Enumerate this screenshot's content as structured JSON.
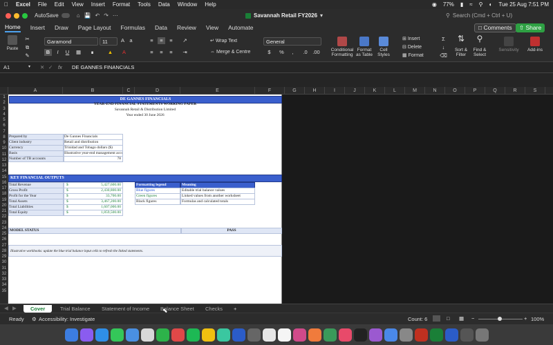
{
  "menubar": {
    "apple": "",
    "app": "Excel",
    "items": [
      "File",
      "Edit",
      "View",
      "Insert",
      "Format",
      "Tools",
      "Data",
      "Window",
      "Help"
    ],
    "battery": "77%",
    "datetime": "Tue 25 Aug  7:51 PM"
  },
  "titlebar": {
    "autosave": "AutoSave",
    "title": "Savannah Retail FY2026",
    "search_placeholder": "Search (Cmd + Ctrl + U)"
  },
  "ribbon_tabs": [
    "Home",
    "Insert",
    "Draw",
    "Page Layout",
    "Formulas",
    "Data",
    "Review",
    "View",
    "Automate"
  ],
  "ribbon": {
    "comments": "Comments",
    "share": "Share",
    "paste": "Paste",
    "font": "Garamond",
    "size": "11",
    "wrap": "Wrap Text",
    "merge": "Merge & Centre",
    "numfmt": "General",
    "cond": "Conditional Formatting",
    "fmt_table": "Format as Table",
    "cell_styles": "Cell Styles",
    "insert": "Insert",
    "delete": "Delete",
    "format": "Format",
    "sort": "Sort & Filter",
    "find": "Find & Select",
    "sensitivity": "Sensitivity",
    "addins": "Add-ins",
    "bold": "B",
    "italic": "I",
    "underline": "U",
    "pct": "%"
  },
  "formula": {
    "cellref": "A1",
    "fx": "fx",
    "value": "DE GANNES FINANCIALS"
  },
  "columns": [
    "A",
    "B",
    "C",
    "D",
    "E",
    "F",
    "G",
    "H",
    "I",
    "J",
    "K",
    "L",
    "M",
    "N",
    "O",
    "P",
    "Q",
    "R",
    "S"
  ],
  "rows": [
    "1",
    "2",
    "3",
    "4",
    "5",
    "6",
    "7",
    "8",
    "9",
    "10",
    "11",
    "12",
    "13",
    "14",
    "15",
    "16",
    "17",
    "18",
    "19",
    "20",
    "21",
    "22",
    "23",
    "24",
    "25",
    "26",
    "27",
    "28",
    "29",
    "30",
    "31",
    "32",
    "33",
    "34",
    "35"
  ],
  "sheet": {
    "title": "DE GANNES FINANCIALS",
    "subtitle": "YEAR-END FINANCIAL STATEMENTS WORKING PAPER",
    "company": "Savannah Retail & Distribution Limited",
    "period": "Year ended 30 June 2026",
    "info": [
      {
        "label": "Prepared by",
        "value": "De Gannes Financials"
      },
      {
        "label": "Client industry",
        "value": "Retail and distribution"
      },
      {
        "label": "Currency",
        "value": "Trinidad and Tobago dollars ($)"
      },
      {
        "label": "Basis",
        "value": "Illustrative year-end management accounts"
      },
      {
        "label": "Number of TB accounts",
        "value": "78"
      }
    ],
    "kfo_title": "KEY FINANCIAL OUTPUTS",
    "outputs": [
      {
        "label": "Total Revenue",
        "cur": "$",
        "value": "5,427,600.00"
      },
      {
        "label": "Gross Profit",
        "cur": "$",
        "value": "2,430,800.00"
      },
      {
        "label": "Profit for the Year",
        "cur": "$",
        "value": "33,700.00"
      },
      {
        "label": "Total Assets",
        "cur": "$",
        "value": "3,467,200.00"
      },
      {
        "label": "Total Liabilities",
        "cur": "$",
        "value": "1,607,000.00"
      },
      {
        "label": "Total Equity",
        "cur": "$",
        "value": "1,859,500.00"
      }
    ],
    "legend": {
      "h1": "Formatting legend",
      "h2": "Meaning",
      "rows": [
        {
          "a": "Blue figures",
          "b": "Editable trial balance values"
        },
        {
          "a": "Green figures",
          "b": "Linked values from another worksheet"
        },
        {
          "a": "Black figures",
          "b": "Formulas and calculated totals"
        }
      ]
    },
    "model_label": "MODEL STATUS",
    "model_value": "PASS",
    "note": "Illustrative workbooks: update the blue trial balance input cells to refresh the linked statements."
  },
  "sheet_tabs": [
    "Cover",
    "Trial Balance",
    "Statement of Income",
    "Balance Sheet",
    "Checks",
    "+"
  ],
  "status": {
    "ready": "Ready",
    "accessibility": "Accessibility: Investigate",
    "count": "Count: 6",
    "zoom": "100%"
  },
  "colors": {
    "accent": "#3a5fcd",
    "excel_green": "#1a7f37",
    "share": "#2ea043"
  }
}
